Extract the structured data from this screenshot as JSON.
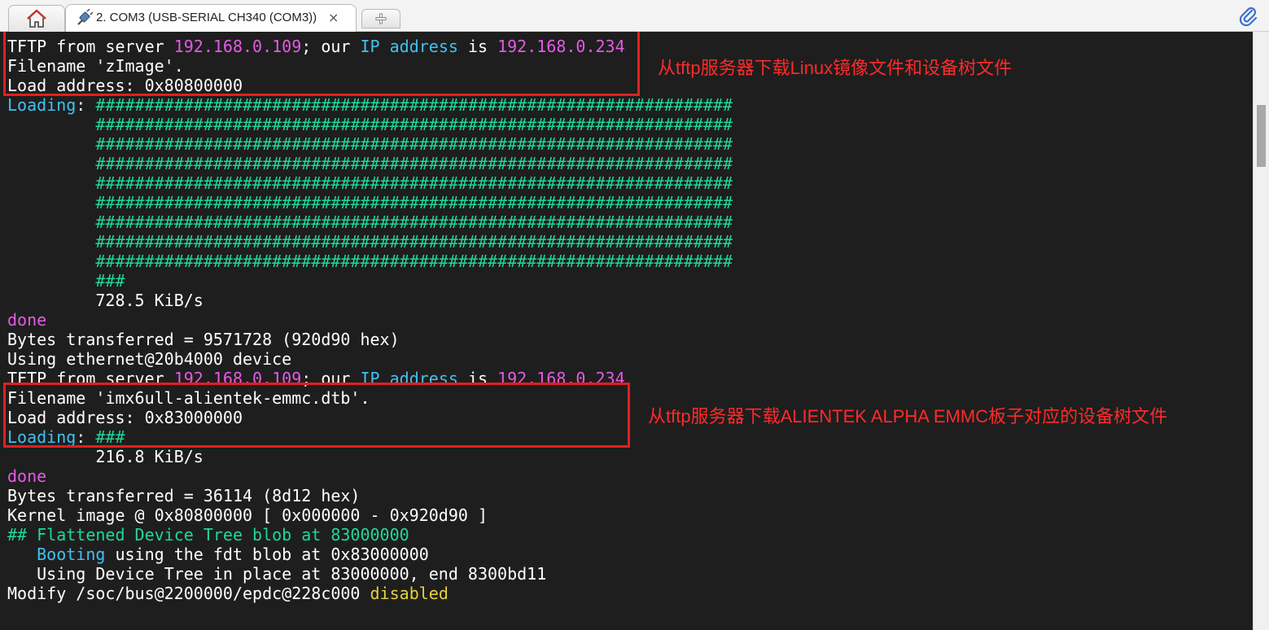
{
  "tabs": {
    "home_icon": "home-icon",
    "session_icon": "plug-icon",
    "session_title": "2. COM3  (USB-SERIAL CH340 (COM3))",
    "close_glyph": "×",
    "new_tab_icon": "plus-icon",
    "attach_icon": "paperclip-icon"
  },
  "terminal": {
    "lines": [
      [
        {
          "t": "TFTP from server "
        },
        {
          "t": "192.168.0.109",
          "c": "magenta"
        },
        {
          "t": "; our "
        },
        {
          "t": "IP address",
          "c": "cyan"
        },
        {
          "t": " is "
        },
        {
          "t": "192.168.0.234",
          "c": "magenta"
        }
      ],
      [
        {
          "t": "Filename 'zImage'."
        }
      ],
      [
        {
          "t": "Load address: 0x80800000"
        }
      ],
      [
        {
          "t": "Loading",
          "c": "cyan"
        },
        {
          "t": ": "
        },
        {
          "t": "#################################################################",
          "c": "green"
        }
      ],
      [
        {
          "t": "         "
        },
        {
          "t": "#################################################################",
          "c": "green"
        }
      ],
      [
        {
          "t": "         "
        },
        {
          "t": "#################################################################",
          "c": "green"
        }
      ],
      [
        {
          "t": "         "
        },
        {
          "t": "#################################################################",
          "c": "green"
        }
      ],
      [
        {
          "t": "         "
        },
        {
          "t": "#################################################################",
          "c": "green"
        }
      ],
      [
        {
          "t": "         "
        },
        {
          "t": "#################################################################",
          "c": "green"
        }
      ],
      [
        {
          "t": "         "
        },
        {
          "t": "#################################################################",
          "c": "green"
        }
      ],
      [
        {
          "t": "         "
        },
        {
          "t": "#################################################################",
          "c": "green"
        }
      ],
      [
        {
          "t": "         "
        },
        {
          "t": "#################################################################",
          "c": "green"
        }
      ],
      [
        {
          "t": "         "
        },
        {
          "t": "###",
          "c": "green"
        }
      ],
      [
        {
          "t": "         728.5 KiB/s"
        }
      ],
      [
        {
          "t": "done",
          "c": "magenta"
        }
      ],
      [
        {
          "t": "Bytes transferred = 9571728 (920d90 hex)"
        }
      ],
      [
        {
          "t": "Using ethernet@20b4000 device"
        }
      ],
      [
        {
          "t": "TFTP from server "
        },
        {
          "t": "192.168.0.109",
          "c": "magenta"
        },
        {
          "t": "; our "
        },
        {
          "t": "IP address",
          "c": "cyan"
        },
        {
          "t": " is "
        },
        {
          "t": "192.168.0.234",
          "c": "magenta"
        }
      ],
      [
        {
          "t": "Filename 'imx6ull-alientek-emmc.dtb'."
        }
      ],
      [
        {
          "t": "Load address: 0x83000000"
        }
      ],
      [
        {
          "t": "Loading",
          "c": "cyan"
        },
        {
          "t": ": "
        },
        {
          "t": "###",
          "c": "green"
        }
      ],
      [
        {
          "t": "         216.8 KiB/s"
        }
      ],
      [
        {
          "t": "done",
          "c": "magenta"
        }
      ],
      [
        {
          "t": "Bytes transferred = 36114 (8d12 hex)"
        }
      ],
      [
        {
          "t": "Kernel image @ 0x80800000 [ 0x000000 - 0x920d90 ]"
        }
      ],
      [
        {
          "t": "## Flattened Device Tree blob at 83000000",
          "c": "green"
        }
      ],
      [
        {
          "t": "   "
        },
        {
          "t": "Booting",
          "c": "cyan"
        },
        {
          "t": " using the fdt blob at 0x83000000"
        }
      ],
      [
        {
          "t": "   Using Device Tree in place at 83000000, end 8300bd11"
        }
      ],
      [
        {
          "t": "Modify /soc/bus@2200000/epdc@228c000 "
        },
        {
          "t": "disabled",
          "c": "yellow"
        }
      ]
    ]
  },
  "annotations": {
    "note1": "从tftp服务器下载Linux镜像文件和设备树文件",
    "note2": "从tftp服务器下载ALIENTEK ALPHA EMMC板子对应的设备树文件",
    "box_color": "#e02020"
  }
}
